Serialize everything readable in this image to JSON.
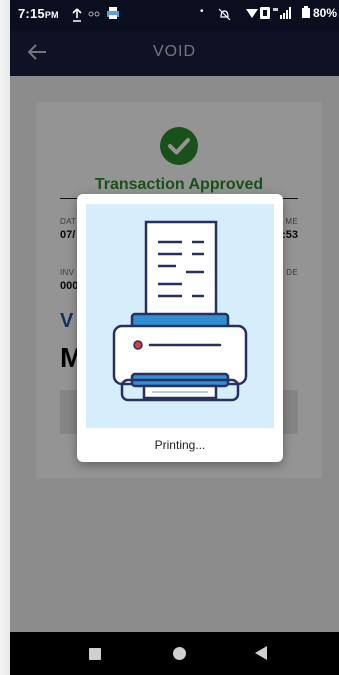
{
  "status_bar": {
    "time": "7:15",
    "ampm": "PM",
    "battery": "80%"
  },
  "app_bar": {
    "title": "VOID"
  },
  "transaction": {
    "status": "Transaction Approved",
    "date_label": "DAT",
    "date_value": "07/",
    "time_label": "ME",
    "time_value": ":53",
    "invoice_label": "INV",
    "invoice_value": "000",
    "code_label": "DE",
    "void_label": "V",
    "amount_partial": "M"
  },
  "dialog": {
    "message": "Printing...",
    "image_icon": "printer-receipt-illustration"
  },
  "colors": {
    "status_bar_bg": "#0b0e1e",
    "app_bar_bg": "#1b2040",
    "approved_green": "#2e8b2e",
    "void_blue": "#1f5aa6",
    "dialog_image_bg": "#d6edfb"
  },
  "icons": {
    "back": "back-arrow-icon",
    "check": "check-circle-icon",
    "nav_recents": "square-icon",
    "nav_home": "circle-icon",
    "nav_back": "triangle-back-icon"
  }
}
